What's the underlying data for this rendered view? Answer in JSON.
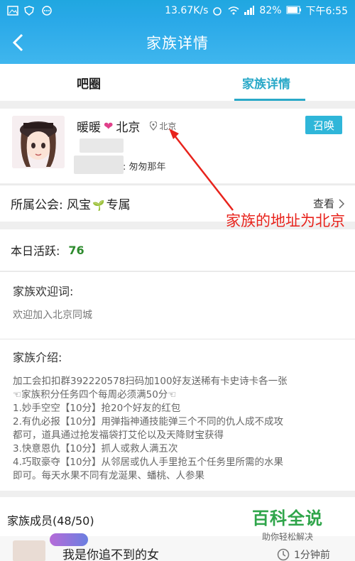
{
  "status": {
    "speed": "13.67K/s",
    "battery": "82%",
    "time": "下午6:55"
  },
  "header": {
    "title": "家族详情"
  },
  "tabs": [
    {
      "label": "吧圈",
      "active": false
    },
    {
      "label": "家族详情",
      "active": true
    }
  ],
  "profile": {
    "name": "暖暖",
    "name_suffix": "北京",
    "location": "北京",
    "motto": ": 匆匆那年",
    "summon_label": "召唤"
  },
  "guild": {
    "label_prefix": "所属公会: 风宝",
    "label_suffix": "专属",
    "view_label": "查看"
  },
  "activity": {
    "label": "本日活跃:",
    "value": "76"
  },
  "welcome": {
    "heading": "家族欢迎词:",
    "text": "欢迎加入北京同城"
  },
  "intro": {
    "heading": "家族介绍:",
    "lines": [
      "加工会扣扣群392220578扫码加100好友送稀有卡史诗卡各一张",
      "☜家族积分任务四个每周必须满50分☜",
      "1.妙手空空【10分】抢20个好友的红包",
      "2.有仇必报【10分】用弹指神通技能弹三个不同的仇人成不成攻",
      "都可，道具通过抢发福袋打艾伦以及天降财宝获得",
      "3.快意恩仇【10分】抓人或救人满五次",
      "4.巧取豪夺【10分】从邻居或仇人手里抢五个任务里所需的水果",
      "即可。每天水果不同有龙涎果、蟠桃、人参果"
    ]
  },
  "members": {
    "heading": "家族成员(48/50)",
    "first_member_name": "我是你追不到的女",
    "first_member_time": "1分钟前"
  },
  "annotation": {
    "text": "家族的地址为北京"
  },
  "watermark": {
    "title": "百科全说",
    "subtitle": "助你轻松解决"
  },
  "colors": {
    "accent": "#2aa9c8",
    "annotation": "#e8231c"
  }
}
